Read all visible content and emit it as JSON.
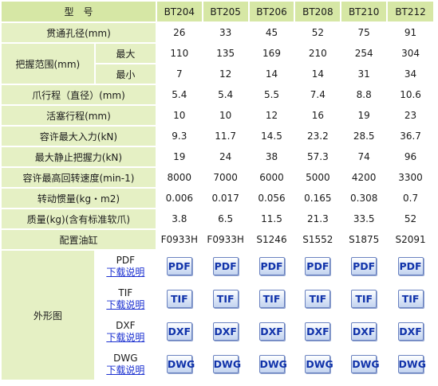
{
  "header": {
    "label": "型　号",
    "models": [
      "BT204",
      "BT205",
      "BT206",
      "BT208",
      "BT210",
      "BT212"
    ]
  },
  "rows": {
    "bore": {
      "label": "贯通孔径(mm)",
      "values": [
        "26",
        "33",
        "45",
        "52",
        "75",
        "91"
      ]
    },
    "grip": {
      "label": "把握范围(mm)",
      "max": {
        "label": "最大",
        "values": [
          "110",
          "135",
          "169",
          "210",
          "254",
          "304"
        ]
      },
      "min": {
        "label": "最小",
        "values": [
          "7",
          "12",
          "14",
          "14",
          "31",
          "34"
        ]
      }
    },
    "jaw_stroke": {
      "label": "爪行程（直径）(mm)",
      "values": [
        "5.4",
        "5.4",
        "5.5",
        "7.4",
        "8.8",
        "10.6"
      ]
    },
    "piston_stroke": {
      "label": "活塞行程(mm)",
      "values": [
        "10",
        "10",
        "12",
        "16",
        "19",
        "23"
      ]
    },
    "max_input": {
      "label": "容许最大入力(kN)",
      "values": [
        "9.3",
        "11.7",
        "14.5",
        "23.2",
        "28.5",
        "36.7"
      ]
    },
    "max_grip": {
      "label": "最大静止把握力(kN)",
      "values": [
        "19",
        "24",
        "38",
        "57.3",
        "74",
        "96"
      ]
    },
    "max_speed": {
      "label": "容许最高回转速度(min-1)",
      "values": [
        "8000",
        "7000",
        "6000",
        "5000",
        "4200",
        "3300"
      ]
    },
    "inertia": {
      "label": "转动惯量(kg・m2)",
      "values": [
        "0.006",
        "0.017",
        "0.056",
        "0.165",
        "0.308",
        "0.7"
      ]
    },
    "mass": {
      "label": "质量(kg)(含有标准软爪)",
      "values": [
        "3.8",
        "6.5",
        "11.5",
        "21.3",
        "33.5",
        "52"
      ]
    },
    "cylinder": {
      "label": "配置油缸",
      "values": [
        "F0933H",
        "F0933H",
        "S1246",
        "S1552",
        "S1875",
        "S2091"
      ]
    }
  },
  "drawings": {
    "label": "外形图",
    "formats": [
      {
        "name": "PDF",
        "link": "下载说明",
        "badge": "PDF"
      },
      {
        "name": "TIF",
        "link": "下载说明",
        "badge": "TIF"
      },
      {
        "name": "DXF",
        "link": "下载说明",
        "badge": "DXF"
      },
      {
        "name": "DWG",
        "link": "下载说明",
        "badge": "DWG"
      }
    ]
  },
  "colors": {
    "header_bg": "#d6e7a5",
    "label_bg": "#e5f0c4",
    "link": "#1a2fd0",
    "badge_text": "#1133aa"
  }
}
